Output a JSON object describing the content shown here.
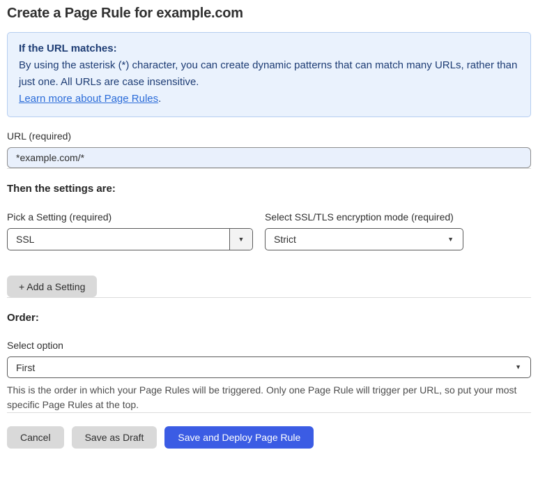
{
  "page": {
    "title": "Create a Page Rule for example.com"
  },
  "info_box": {
    "heading": "If the URL matches:",
    "body": "By using the asterisk (*) character, you can create dynamic patterns that can match many URLs, rather than just one. All URLs are case insensitive.",
    "link_label": "Learn more about Page Rules",
    "link_suffix": "."
  },
  "url_field": {
    "label": "URL (required)",
    "value": "*example.com/*"
  },
  "settings_section": {
    "heading": "Then the settings are:",
    "setting_select": {
      "label": "Pick a Setting (required)",
      "value": "SSL"
    },
    "mode_select": {
      "label": "Select SSL/TLS encryption mode (required)",
      "value": "Strict"
    },
    "add_setting_label": "+ Add a Setting"
  },
  "order_section": {
    "heading": "Order:",
    "select": {
      "label": "Select option",
      "value": "First"
    },
    "help_text": "This is the order in which your Page Rules will be triggered. Only one Page Rule will trigger per URL, so put your most specific Page Rules at the top."
  },
  "footer": {
    "cancel_label": "Cancel",
    "save_draft_label": "Save as Draft",
    "save_deploy_label": "Save and Deploy Page Rule"
  },
  "icons": {
    "dropdown_arrow": "▼"
  },
  "colors": {
    "primary_button": "#3b5ce4",
    "info_box_bg": "#eaf2fd",
    "info_box_border": "#b5cdf0",
    "info_text": "#1d3c74",
    "link": "#2b6cd9",
    "url_input_bg": "#e9f0fc",
    "gray_button_bg": "#d9d9d9",
    "divider": "#dcdcdc",
    "select_border": "#5a5a5a"
  }
}
